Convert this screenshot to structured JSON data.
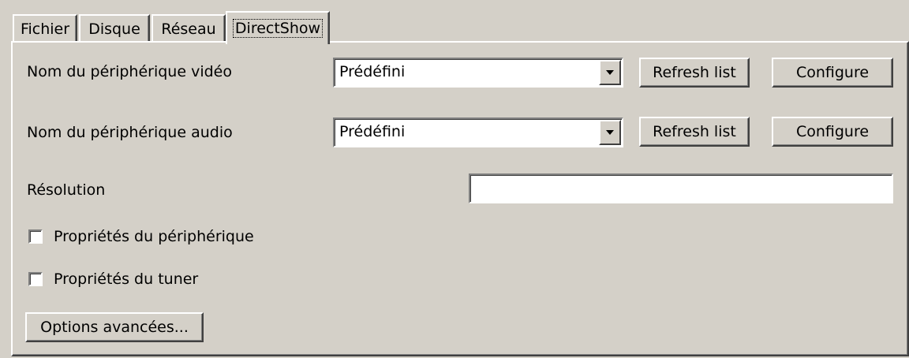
{
  "tabs": [
    {
      "label": "Fichier"
    },
    {
      "label": "Disque"
    },
    {
      "label": "Réseau"
    },
    {
      "label": "DirectShow"
    }
  ],
  "active_tab": "DirectShow",
  "video_device": {
    "label": "Nom du périphérique vidéo",
    "selected": "Prédéfini",
    "refresh_label": "Refresh list",
    "configure_label": "Configure"
  },
  "audio_device": {
    "label": "Nom du périphérique audio",
    "selected": "Prédéfini",
    "refresh_label": "Refresh list",
    "configure_label": "Configure"
  },
  "resolution": {
    "label": "Résolution",
    "value": ""
  },
  "device_properties": {
    "label": "Propriétés du périphérique",
    "checked": false
  },
  "tuner_properties": {
    "label": "Propriétés du tuner",
    "checked": false
  },
  "advanced_options_label": "Options avancées..."
}
